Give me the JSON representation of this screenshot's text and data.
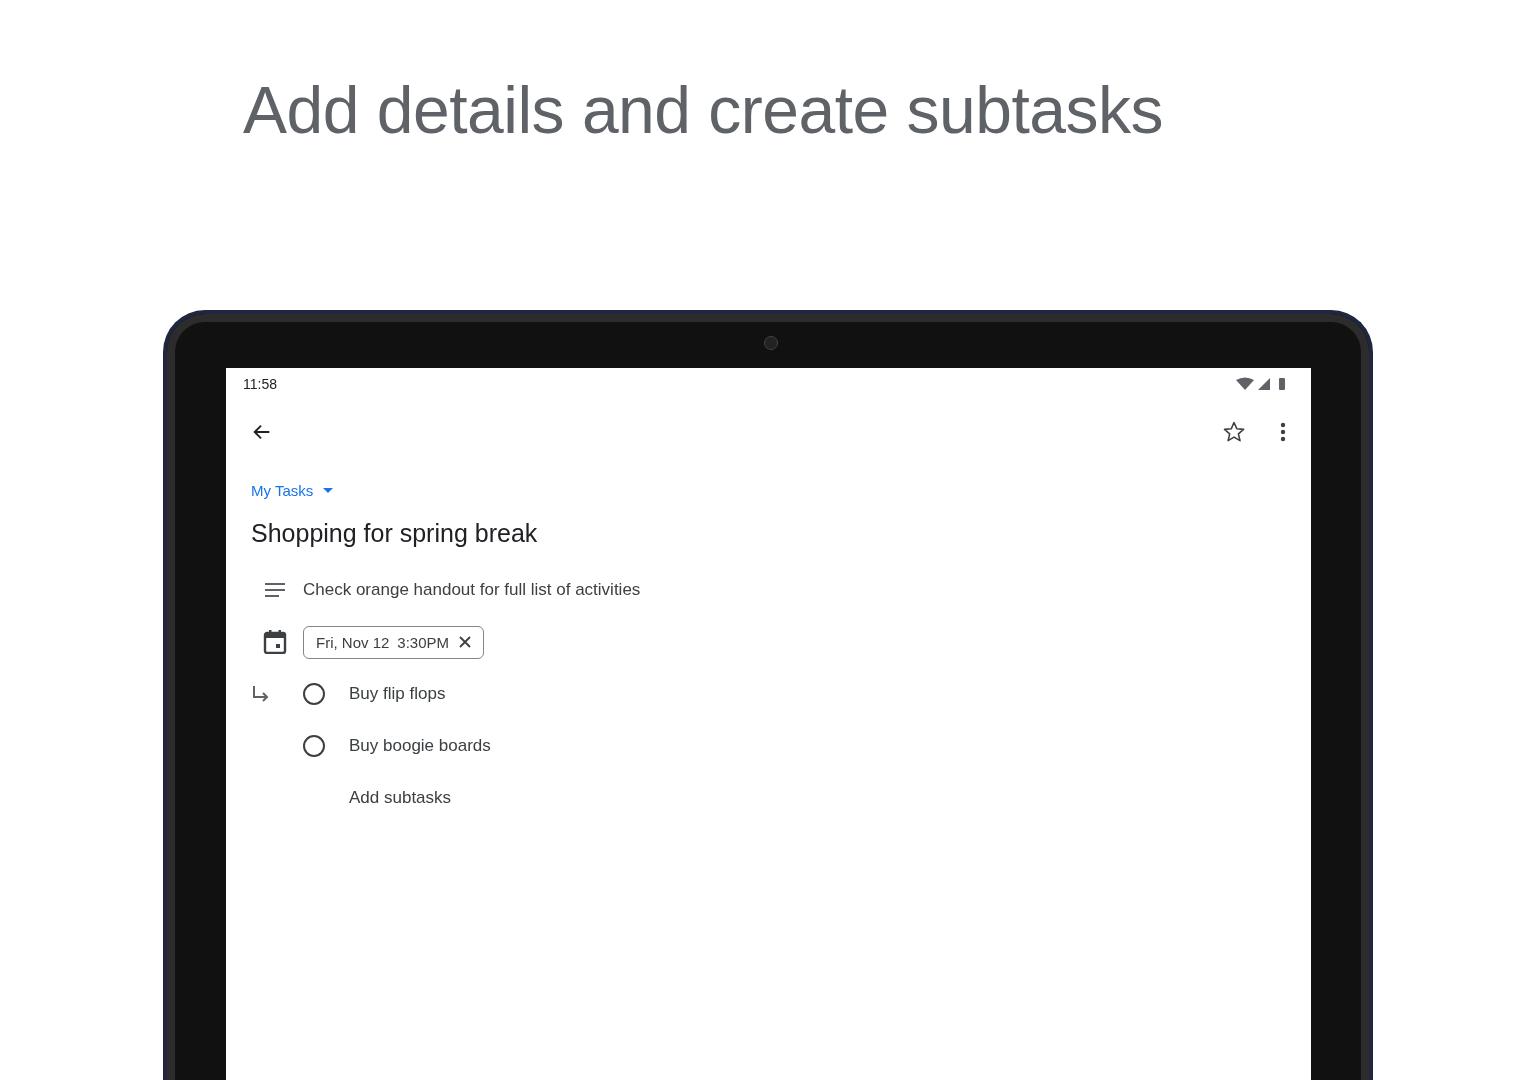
{
  "headline": "Add details and create subtasks",
  "status_bar": {
    "time": "11:58"
  },
  "list_selector": {
    "label": "My Tasks"
  },
  "task": {
    "title": "Shopping for spring break",
    "details": "Check orange handout for full list of activities",
    "date_chip": {
      "date": "Fri, Nov 12",
      "time": "3:30PM"
    },
    "starred": false
  },
  "subtasks": [
    {
      "title": "Buy flip flops",
      "checked": false
    },
    {
      "title": "Buy boogie boards",
      "checked": false
    }
  ],
  "add_subtasks": "Add subtasks"
}
